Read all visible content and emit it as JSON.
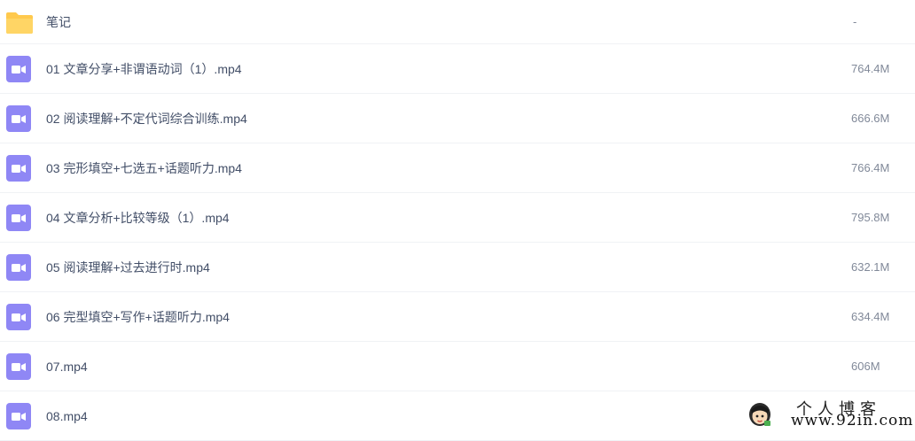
{
  "files": [
    {
      "name": "笔记",
      "size": "-",
      "icon": "folder-icon"
    },
    {
      "name": "01 文章分享+非谓语动词（1）.mp4",
      "size": "764.4M",
      "icon": "video-file-icon"
    },
    {
      "name": "02 阅读理解+不定代词综合训练.mp4",
      "size": "666.6M",
      "icon": "video-file-icon"
    },
    {
      "name": "03 完形填空+七选五+话题听力.mp4",
      "size": "766.4M",
      "icon": "video-file-icon"
    },
    {
      "name": "04 文章分析+比较等级（1）.mp4",
      "size": "795.8M",
      "icon": "video-file-icon"
    },
    {
      "name": "05 阅读理解+过去进行时.mp4",
      "size": "632.1M",
      "icon": "video-file-icon"
    },
    {
      "name": "06 完型填空+写作+话题听力.mp4",
      "size": "634.4M",
      "icon": "video-file-icon"
    },
    {
      "name": "07.mp4",
      "size": "606M",
      "icon": "video-file-icon"
    },
    {
      "name": "08.mp4",
      "size": "",
      "icon": "video-file-icon"
    }
  ],
  "watermark": {
    "title": "个人博客",
    "url": "www.92in.com"
  },
  "colors": {
    "folder": "#ffc94d",
    "video_icon": "#8f87f5",
    "text": "#424e67",
    "size_text": "#818999",
    "divider": "#f0f2f5"
  }
}
